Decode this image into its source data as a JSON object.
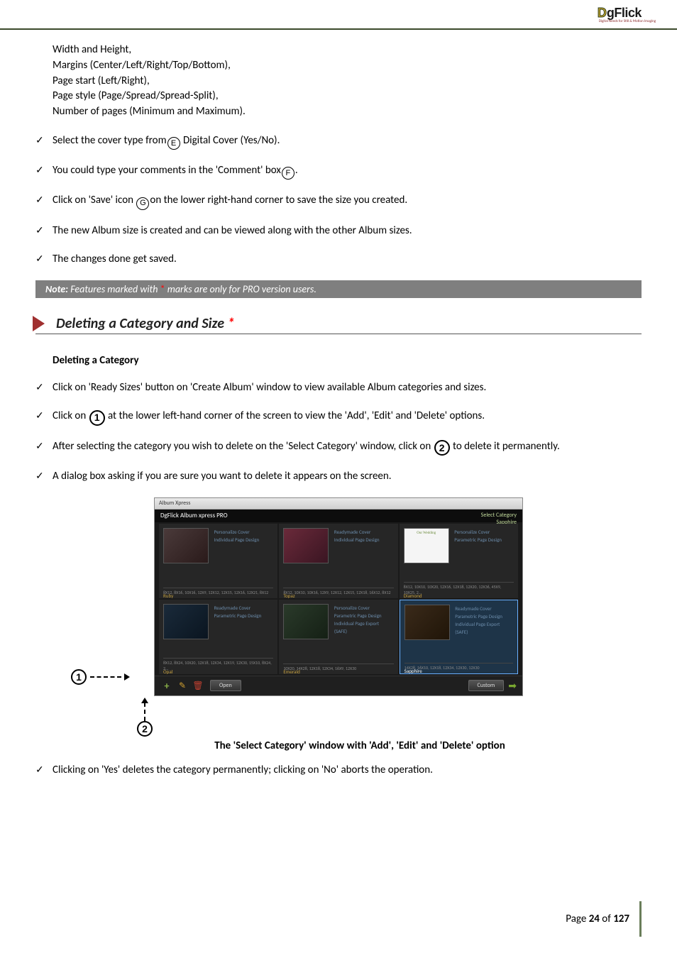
{
  "header": {
    "logo_d": "D",
    "logo_rest": "gFlick",
    "logo_tagline": "Digital Needs for Still & Motion Imaging"
  },
  "specs": {
    "l1": "Width and Height,",
    "l2": "Margins (Center/Left/Right/Top/Bottom),",
    "l3": "Page start (Left/Right),",
    "l4": "Page style (Page/Spread/Spread-Split),",
    "l5": "Number of pages (Minimum and Maximum)."
  },
  "items1": {
    "i1a": "Select the cover type from",
    "i1b": " Digital Cover (Yes/No).",
    "i1_circ": "E",
    "i2a": "You could type your comments in the 'Comment' box",
    "i2b": ".",
    "i2_circ": "F",
    "i3a": "Click on 'Save' icon ",
    "i3b": "on the lower right-hand corner to save the size you created.",
    "i3_circ": "G",
    "i4": "The new Album size is created and can be viewed along with the other Album sizes.",
    "i5": "The changes done get saved."
  },
  "note": {
    "label": "Note:",
    "text_a": " Features marked with ",
    "star": "*",
    "text_b": " marks are only for PRO version users."
  },
  "section": {
    "title": "Deleting a Category and Size ",
    "star": "*"
  },
  "subhead": "Deleting a Category",
  "items2": {
    "i1": "Click on 'Ready Sizes' button on 'Create Album' window to view available Album categories and sizes.",
    "i2a": "Click on ",
    "i2b": " at the lower left-hand corner of the screen to view the 'Add', 'Edit' and 'Delete' options.",
    "i2_circ": "1",
    "i3a": "After selecting the category you wish to delete on the 'Select Category' window, click on ",
    "i3b": " to delete it permanently.",
    "i3_circ": "2",
    "i4": "A dialog box asking if you are sure you want to delete it appears on the screen.",
    "i5": "Clicking on 'Yes' deletes the category permanently; clicking on 'No' aborts the operation."
  },
  "anno": {
    "c1": "1",
    "c2": "2"
  },
  "caption": "The 'Select Category' window with 'Add', 'Edit' and 'Delete' option",
  "screenshot": {
    "titlebar": "Album Xpress",
    "brand": "DgFlick  Album xpress PRO",
    "topright_a": "Select Category",
    "topright_b": "Sapphire",
    "cells": [
      {
        "name": "Ruby",
        "t1": "Personalize Cover",
        "t2": "Individual Page Design",
        "sizes": "8X12, 8X16, 10X16, 12X9, 12X12, 12X15, 12X16, 12X21, 8X12"
      },
      {
        "name": "Topaz",
        "t1": "Readymade Cover",
        "t2": "Individual Page Design",
        "sizes": "8X12, 10X10, 10X16, 12X9, 12X12, 12X15, 12X18, 16X12, 8X12"
      },
      {
        "name": "Diamond",
        "t1": "Personalize Cover",
        "t2": "Parametric Page Design",
        "sizes": "8X12, 10X10, 10X20, 12X16, 12X18, 12X20, 12X36, 45X9, 10X25, 2…",
        "book": "Our Wedding"
      },
      {
        "name": "Opal",
        "t1": "Readymade Cover",
        "t2": "Parametric Page Design",
        "sizes": "8X12, 8X24, 10X20, 12X18, 12X34, 12X19, 12X30, 15X10, 8X24, 2…"
      },
      {
        "name": "Emerald",
        "t1": "Personalize Cover",
        "t2": "Parametric Page Design",
        "t3": "Individual Page Export (SAFE)",
        "sizes": "10X20, 14X28, 12X18, 12X34, 16X9, 12X30"
      },
      {
        "name": "Sapphire",
        "t1": "Readymade Cover",
        "t2": "Parametric Page Design",
        "t3": "Individual Page Export (SAFE)",
        "sizes": "14X28, 16X10, 12X18, 12X34, 12X30, 12X30",
        "sel": true
      }
    ],
    "open": "Open",
    "custom": "Custom"
  },
  "footer": {
    "a": "Page ",
    "num": "24",
    "b": " of ",
    "total": "127"
  }
}
